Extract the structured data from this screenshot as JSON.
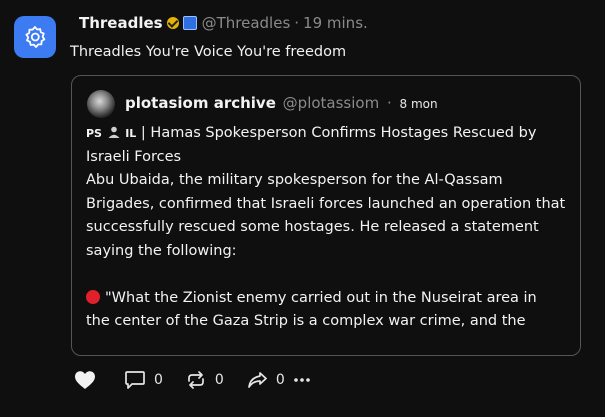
{
  "post": {
    "author": "Threadles",
    "handle": "@Threadles",
    "separator": "·",
    "time": "19 mins.",
    "text": "Threadles You're Voice You're freedom"
  },
  "quote": {
    "author": "plotasiom archive",
    "handle": "@plotassiom",
    "separator": "·",
    "time": "8 mon",
    "flag_prefix": "PS",
    "flag_suffix": "IL",
    "headline": "| Hamas Spokesperson Confirms Hostages Rescued by Israeli Forces",
    "paragraph": "Abu Ubaida, the military spokesperson for the Al-Qassam Brigades, confirmed that Israeli forces launched an operation that successfully rescued some hostages. He released a statement saying the following:",
    "quote_line_1": "\"What the Zionist enemy carried out in the Nuseirat area in",
    "quote_line_2": "the center of the Gaza Strip is a complex war crime, and the"
  },
  "actions": {
    "reply_count": "0",
    "repost_count": "0",
    "share_count": "0"
  },
  "icons": {
    "avatar": "gear-icon",
    "like": "heart-icon",
    "reply": "comment-icon",
    "repost": "repost-icon",
    "share": "share-icon",
    "more": "more-icon"
  },
  "colors": {
    "background": "#0f0f0f",
    "avatar": "#3d7bf2",
    "verified": "#e6b400",
    "alert_dot": "#e0202a"
  }
}
